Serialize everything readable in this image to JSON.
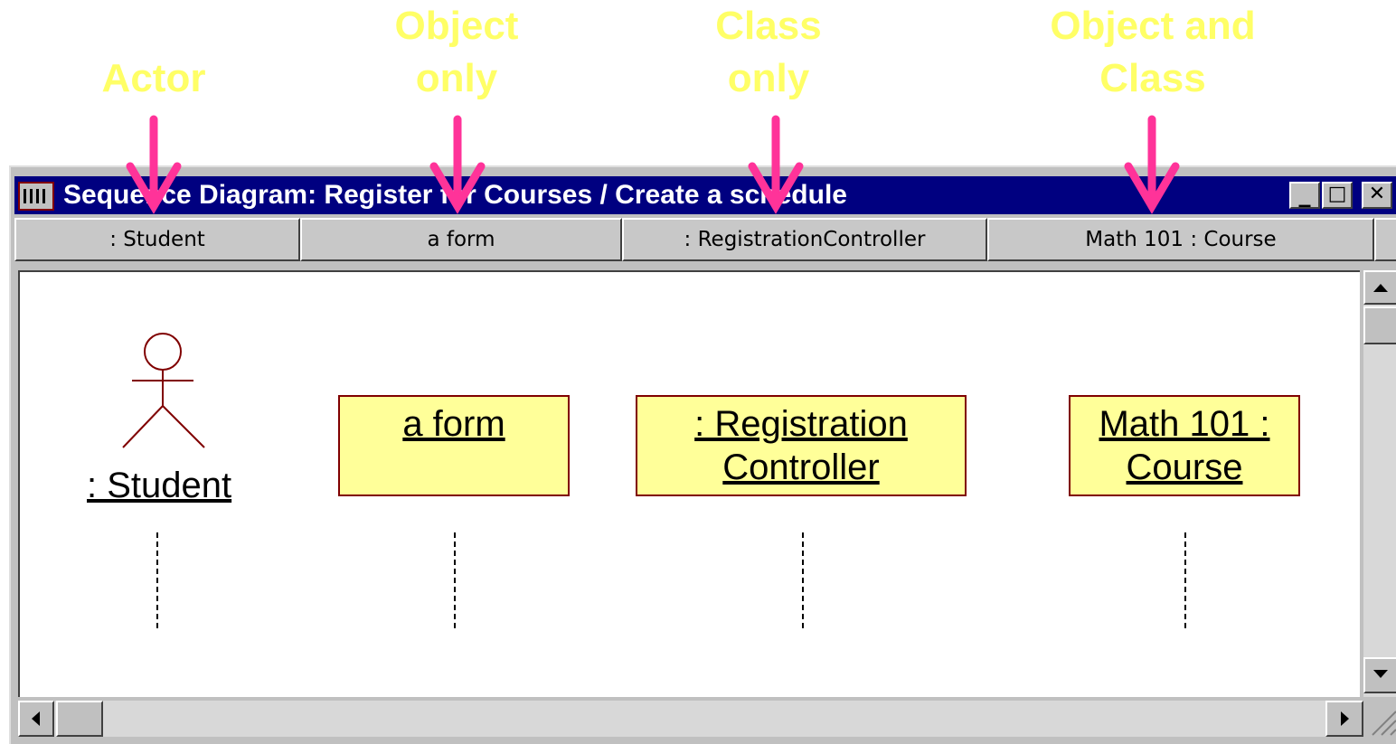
{
  "callouts": [
    {
      "line1": "",
      "line2": "Actor"
    },
    {
      "line1": "Object",
      "line2": "only"
    },
    {
      "line1": "Class",
      "line2": "only"
    },
    {
      "line1": "Object and",
      "line2": "Class"
    }
  ],
  "window": {
    "title": "Sequence Diagram: Register for Courses / Create a schedule",
    "minimize": "_",
    "maximize": "□",
    "close": "✕"
  },
  "header": [
    ": Student",
    "a form",
    ": RegistrationController",
    "Math 101 : Course"
  ],
  "diagram": {
    "actor": {
      "label": ": Student",
      "icon": "stick-figure-icon"
    },
    "objects": [
      {
        "line1": "a form",
        "line2": ""
      },
      {
        "line1": ": Registration",
        "line2": "Controller"
      },
      {
        "line1": "Math 101 :",
        "line2": "Course"
      }
    ]
  },
  "colors": {
    "callout": "#ffff66",
    "arrow": "#ff3399",
    "titlebar": "#000080",
    "object_fill": "#ffff99",
    "object_border": "#800000"
  }
}
